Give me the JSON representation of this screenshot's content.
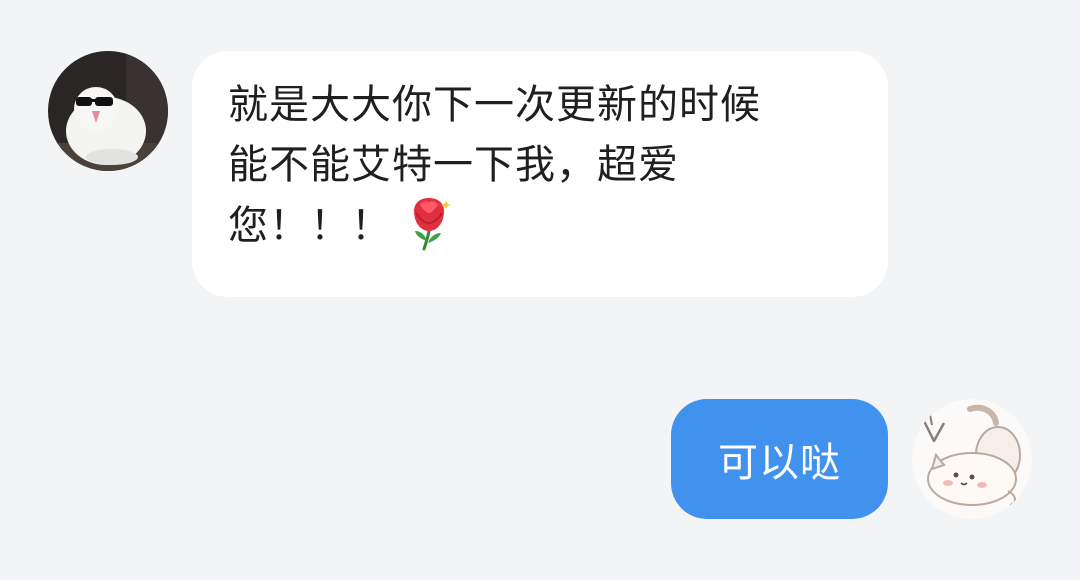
{
  "conversation": {
    "messages": [
      {
        "sender": "other",
        "avatar_icon": "sunglasses-bird-avatar",
        "lines": [
          "就是大大你下一次更新的时候",
          "能不能艾特一下我，超爱",
          "您！！！"
        ],
        "emoji": "rose-emoji"
      },
      {
        "sender": "self",
        "avatar_icon": "cat-sticker-avatar",
        "text": "可以哒"
      }
    ]
  },
  "colors": {
    "background": "#f3f4f6",
    "incoming_bubble": "#ffffff",
    "outgoing_bubble": "#4192ee",
    "incoming_text": "#1f1f1f",
    "outgoing_text": "#ffffff"
  }
}
